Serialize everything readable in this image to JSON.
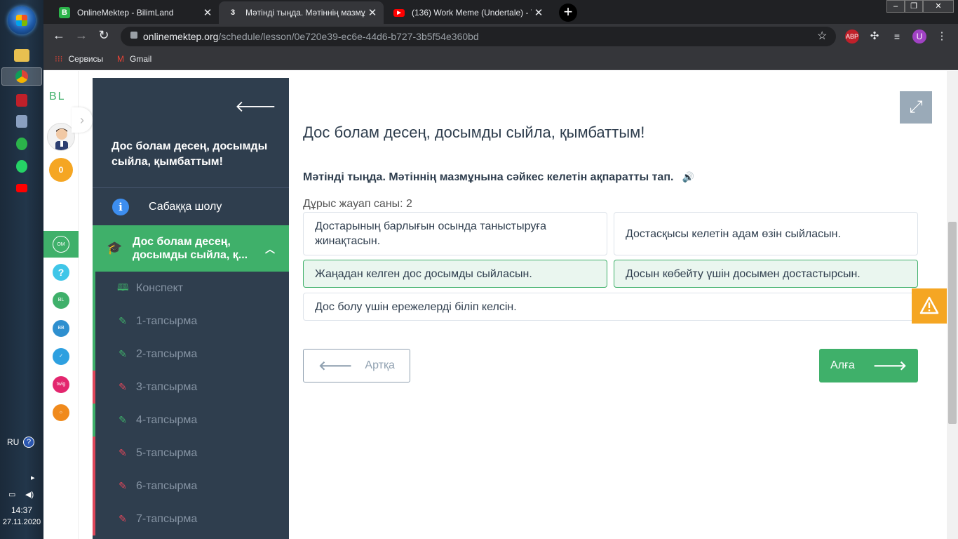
{
  "browser": {
    "tabs": [
      {
        "title": "OnlineMektep - BilimLand",
        "favicon": "bilimland-icon",
        "active": false
      },
      {
        "title": "Мәтінді тыңда. Мәтіннің мазмұ",
        "favicon": "page-3-icon",
        "active": true
      },
      {
        "title": "(136) Work Meme (Undertale) - Y",
        "favicon": "youtube-icon",
        "active": false
      }
    ],
    "url_host": "onlinemektep.org",
    "url_path": "/schedule/lesson/0e720e39-ec6e-44d6-b727-3b5f54e360bd",
    "profile_initial": "U",
    "bookmarks": [
      {
        "label": "Сервисы",
        "icon": "apps-grid-icon"
      },
      {
        "label": "Gmail",
        "icon": "gmail-icon"
      }
    ]
  },
  "taskbar": {
    "language": "RU",
    "time": "14:37",
    "date": "27.11.2020"
  },
  "rail": {
    "logo": "BL",
    "points": "0"
  },
  "lesson": {
    "title": "Дос болам десең, досымды сыйла, қымбаттым!",
    "overview_label": "Сабаққа шолу",
    "active_section": "Дос болам десең, досымды сыйла, қ...",
    "items": [
      {
        "label": "Конспект",
        "icon": "book-icon",
        "status": "green"
      },
      {
        "label": "1-тапсырма",
        "icon": "edit-icon",
        "status": "green"
      },
      {
        "label": "2-тапсырма",
        "icon": "edit-icon",
        "status": "green"
      },
      {
        "label": "3-тапсырма",
        "icon": "edit-icon",
        "status": "red"
      },
      {
        "label": "4-тапсырма",
        "icon": "edit-icon",
        "status": "green"
      },
      {
        "label": "5-тапсырма",
        "icon": "edit-icon",
        "status": "red"
      },
      {
        "label": "6-тапсырма",
        "icon": "edit-icon",
        "status": "red"
      },
      {
        "label": "7-тапсырма",
        "icon": "edit-icon",
        "status": "red"
      }
    ]
  },
  "task": {
    "title": "Дос болам десең, досымды сыйла, қымбаттым!",
    "question": "Мәтінді тыңда. Мәтіннің мазмұнына сәйкес келетін ақпаратты тап.",
    "correct_count": "Дұрыс жауап саны: 2",
    "answers": [
      {
        "text": "Достарының барлығын осында таныстыруға жинақтасын.",
        "selected": false
      },
      {
        "text": "Достасқысы келетін адам өзін сыйласын.",
        "selected": false
      },
      {
        "text": "Жаңадан келген дос досымды сыйласын.",
        "selected": true
      },
      {
        "text": "Досын көбейту үшін досымен достастырсын.",
        "selected": true
      },
      {
        "text": "Дос болу үшін ережелерді біліп келсін.",
        "selected": false
      }
    ],
    "back_label": "Артқа",
    "next_label": "Алға"
  },
  "colors": {
    "accent_green": "#3fb06a",
    "panel_dark": "#2f3e4e",
    "status_red": "#e0475a",
    "warning_orange": "#f5a623"
  }
}
